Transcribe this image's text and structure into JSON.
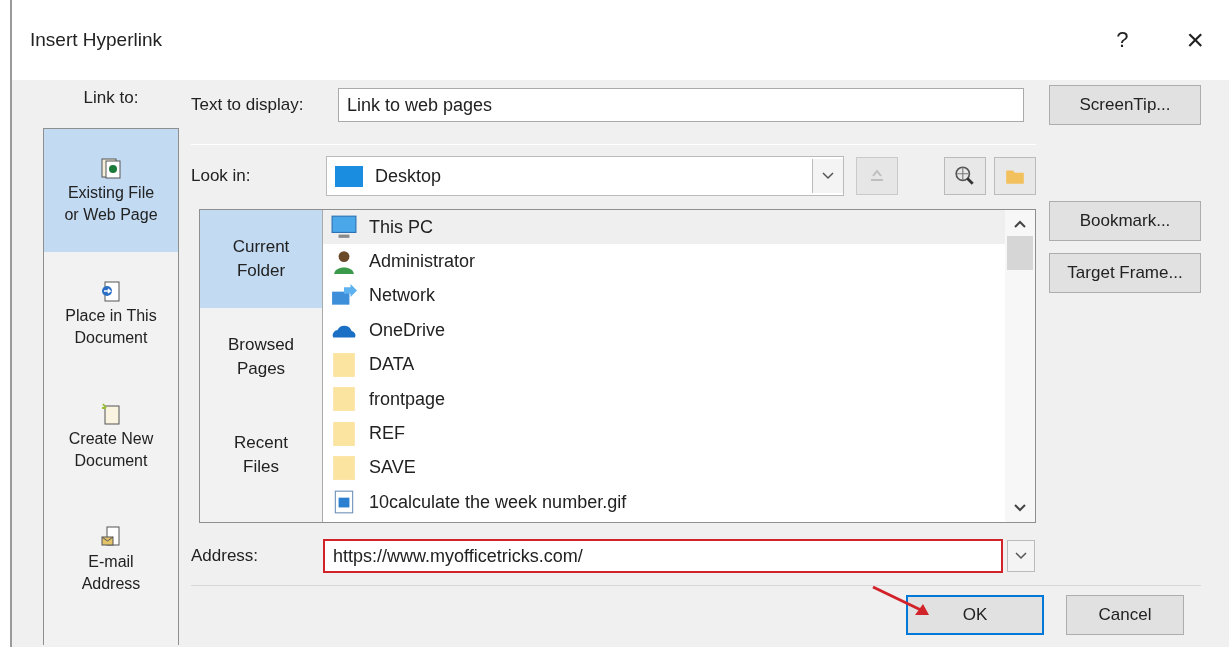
{
  "window": {
    "title": "Insert Hyperlink",
    "help": "?",
    "close": "×"
  },
  "link_to": {
    "label": "Link to:",
    "items": [
      {
        "kind": "file",
        "label": "Existing File or Web Page",
        "selected": true
      },
      {
        "kind": "place",
        "label": "Place in This Document",
        "selected": false
      },
      {
        "kind": "new",
        "label": "Create New Document",
        "selected": false
      },
      {
        "kind": "email",
        "label": "E-mail Address",
        "selected": false
      }
    ]
  },
  "text_to_display": {
    "label": "Text to display:",
    "value": "Link to web pages"
  },
  "look_in": {
    "label": "Look in:",
    "value": "Desktop"
  },
  "toolbar": [
    {
      "kind": "up",
      "disabled": true
    },
    {
      "kind": "web",
      "disabled": false
    },
    {
      "kind": "file",
      "disabled": false
    }
  ],
  "views": [
    {
      "label": "Current Folder",
      "selected": true
    },
    {
      "label": "Browsed Pages",
      "selected": false
    },
    {
      "label": "Recent Files",
      "selected": false
    }
  ],
  "files": [
    {
      "kind": "pc",
      "name": "This PC",
      "selected": true
    },
    {
      "kind": "user",
      "name": "Administrator",
      "selected": false
    },
    {
      "kind": "network",
      "name": "Network",
      "selected": false
    },
    {
      "kind": "cloud",
      "name": "OneDrive",
      "selected": false
    },
    {
      "kind": "folder",
      "name": "DATA",
      "selected": false
    },
    {
      "kind": "folder",
      "name": "frontpage",
      "selected": false
    },
    {
      "kind": "folder",
      "name": "REF",
      "selected": false
    },
    {
      "kind": "folder",
      "name": "SAVE",
      "selected": false
    },
    {
      "kind": "image",
      "name": "10calculate the week number.gif",
      "selected": false
    }
  ],
  "address": {
    "label": "Address:",
    "value": "https://www.myofficetricks.com/",
    "highlighted": true
  },
  "side_buttons": [
    "ScreenTip...",
    "Bookmark...",
    "Target Frame..."
  ],
  "footer_buttons": [
    {
      "label": "OK",
      "default": true
    },
    {
      "label": "Cancel",
      "default": false
    }
  ],
  "annotation": {
    "arrow": true
  }
}
